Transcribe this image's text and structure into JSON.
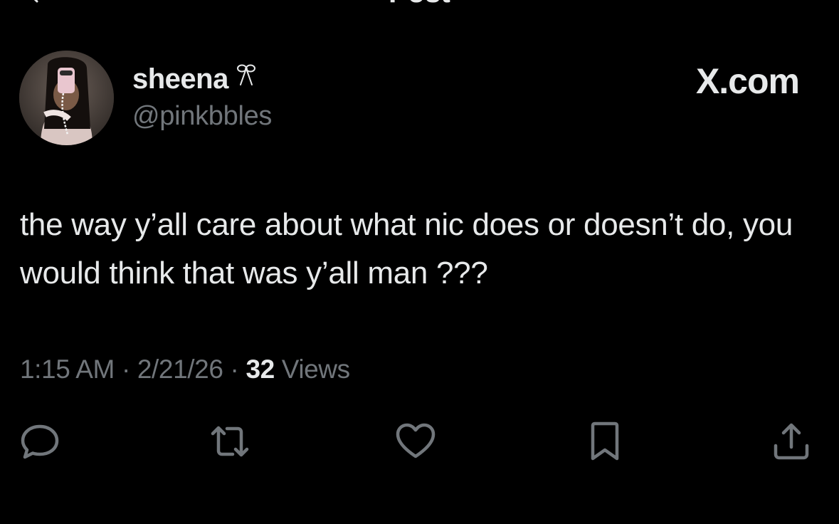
{
  "header": {
    "title": "Post"
  },
  "user": {
    "display_name": "sheena",
    "name_emoji": "🎀",
    "handle": "@pinkbbles"
  },
  "brand": {
    "label": "X.com"
  },
  "tweet": {
    "text": "the way y’all care about what nic does or doesn’t do, you would think that was y’all man ???"
  },
  "meta": {
    "time": "1:15 AM",
    "date": "2/21/26",
    "views_count": "32",
    "views_label": "Views"
  },
  "actions": {
    "icons": [
      "reply-icon",
      "retweet-icon",
      "like-icon",
      "bookmark-icon",
      "share-icon"
    ]
  },
  "colors": {
    "background": "#000000",
    "primary_text": "#e7e9ea",
    "secondary_text": "#71767b"
  }
}
